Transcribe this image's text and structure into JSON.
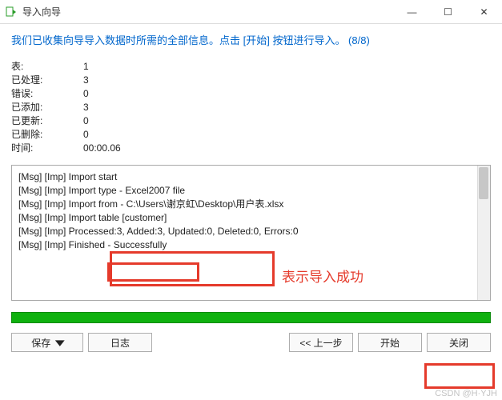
{
  "window": {
    "title": "导入向导",
    "minimize_glyph": "—",
    "maximize_glyph": "☐",
    "close_glyph": "✕"
  },
  "instruction": "我们已收集向导导入数据时所需的全部信息。点击 [开始] 按钮进行导入。 (8/8)",
  "stats": {
    "rows": [
      {
        "label": "表:",
        "value": "1"
      },
      {
        "label": "已处理:",
        "value": "3"
      },
      {
        "label": "错误:",
        "value": "0"
      },
      {
        "label": "已添加:",
        "value": "3"
      },
      {
        "label": "已更新:",
        "value": "0"
      },
      {
        "label": "已删除:",
        "value": "0"
      },
      {
        "label": "时间:",
        "value": "00:00.06"
      }
    ]
  },
  "log": {
    "lines": [
      "[Msg] [Imp] Import start",
      "[Msg] [Imp] Import type - Excel2007 file",
      "[Msg] [Imp] Import from - C:\\Users\\谢京虹\\Desktop\\用户表.xlsx",
      "[Msg] [Imp] Import table [customer]",
      "[Msg] [Imp] Processed:3, Added:3, Updated:0, Deleted:0, Errors:0",
      "[Msg] [Imp] Finished - Successfully"
    ]
  },
  "annotations": {
    "success_label": "表示导入成功"
  },
  "buttons": {
    "save": "保存",
    "log": "日志",
    "back": "<< 上一步",
    "start": "开始",
    "close": "关闭",
    "caret": "▾"
  },
  "watermark": "CSDN @H·YJH"
}
